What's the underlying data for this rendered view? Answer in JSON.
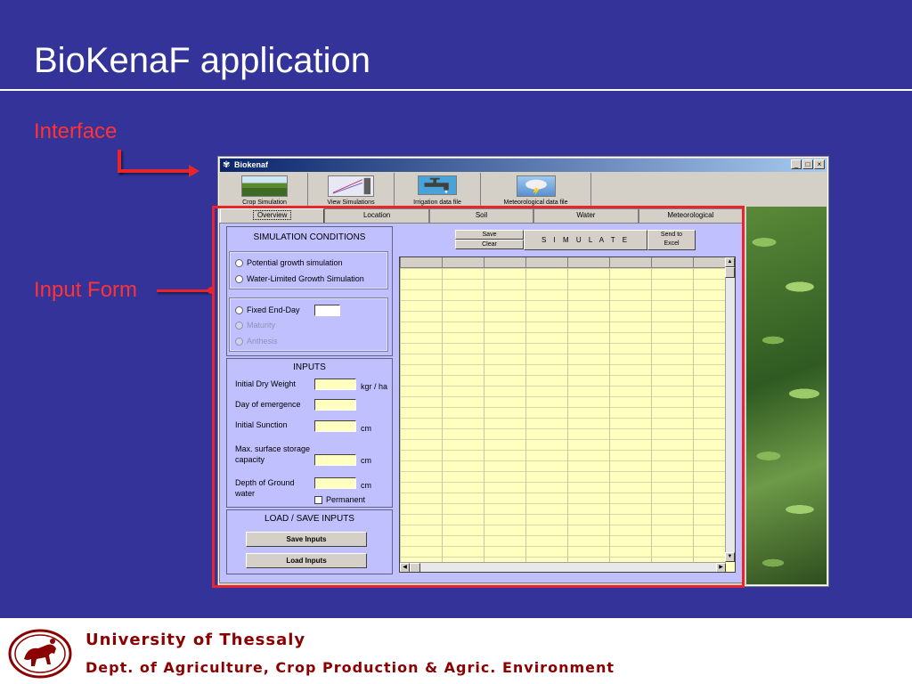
{
  "slide": {
    "title": "BioKenaF application",
    "label_interface": "Interface",
    "label_input_form": "Input Form"
  },
  "window": {
    "title": "Biokenaf",
    "controls": [
      "_",
      "□",
      "×"
    ]
  },
  "toolbar": [
    {
      "label": "Crop Simulation",
      "icon": "crop-field-icon"
    },
    {
      "label": "View Simulations",
      "icon": "chart-icon"
    },
    {
      "label": "Irrigation data file",
      "icon": "faucet-icon"
    },
    {
      "label": "Meteorological data file",
      "icon": "weather-icon"
    }
  ],
  "tabs": [
    "Overview",
    "Location",
    "Soil",
    "Water",
    "Meteorological"
  ],
  "simulation_conditions": {
    "title": "SIMULATION CONDITIONS",
    "options": [
      "Potential growth simulation",
      "Water-Limited Growth Simulation"
    ],
    "end_options": [
      "Fixed End-Day",
      "Maturity",
      "Anthesis"
    ]
  },
  "inputs": {
    "title": "INPUTS",
    "initial_dry_weight": "Initial Dry Weight",
    "unit_kgr_ha": "kgr / ha",
    "day_of_emergence": "Day of emergence",
    "initial_sunction": "Initial Sunction",
    "unit_cm": "cm",
    "max_surface_storage_1": "Max. surface storage",
    "max_surface_storage_2": "capacity",
    "depth_ground_1": "Depth of Ground",
    "depth_ground_2": "water",
    "permanent": "Permanent"
  },
  "load_save": {
    "title": "LOAD / SAVE INPUTS",
    "save_inputs": "Save Inputs",
    "load_inputs": "Load Inputs"
  },
  "actions": {
    "save": "Save",
    "clear": "Clear",
    "simulate": "S I M U L A T E",
    "send_to_1": "Send to",
    "send_to_2": "Excel"
  },
  "footer": {
    "university": "University of Thessaly",
    "department": "Dept. of Agriculture, Crop Production & Agric. Environment"
  },
  "colors": {
    "slide_bg": "#333399",
    "accent_red": "#e8242c",
    "form_bg": "#c0c0ff",
    "field_bg": "#ffffc0",
    "footer_text": "#8b0000"
  }
}
